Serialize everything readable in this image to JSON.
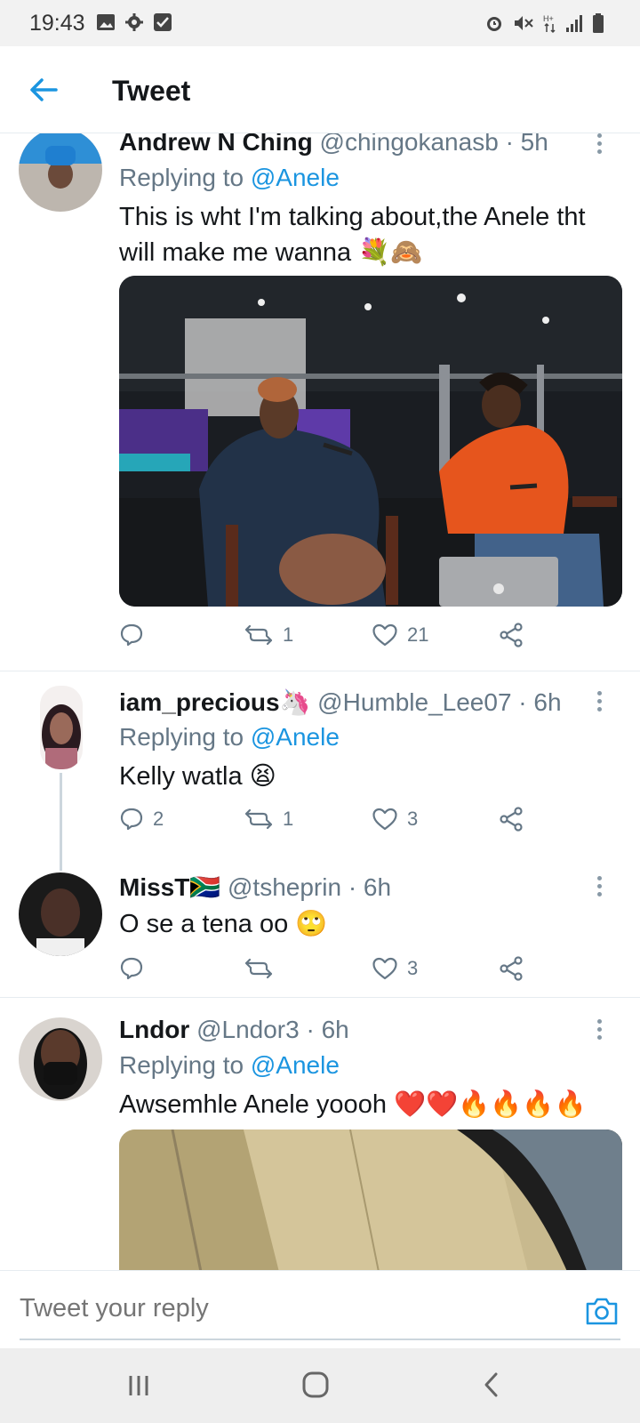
{
  "status_bar": {
    "time": "19:43",
    "left_icons": [
      "image-icon",
      "gear-icon",
      "checkbox-icon"
    ],
    "right_icons": [
      "alarm-icon",
      "mute-icon",
      "data-icon",
      "signal-icon",
      "battery-icon"
    ]
  },
  "header": {
    "back_icon": "arrow-left-icon",
    "title": "Tweet"
  },
  "tweets": [
    {
      "name": "Andrew N Ching",
      "handle": "@chingokanasb",
      "time": "· 5h",
      "replying_prefix": "Replying to",
      "replying_to": "@Anele",
      "text": "This is wht I'm talking about,the Anele tht will make me wanna 💐🙈",
      "has_photo": true,
      "reply_count": "",
      "retweet_count": "1",
      "like_count": "21"
    },
    {
      "name": "iam_precious🦄",
      "handle": "@Humble_Lee07",
      "time": "· 6h",
      "replying_prefix": "Replying to",
      "replying_to": "@Anele",
      "text": "Kelly watla 😫",
      "reply_count": "2",
      "retweet_count": "1",
      "like_count": "3"
    },
    {
      "name": "MissT🇿🇦",
      "handle": "@tsheprin",
      "time": "· 6h",
      "text": "O se a tena oo 🙄",
      "reply_count": "",
      "retweet_count": "",
      "like_count": "3"
    },
    {
      "name": "Lndor",
      "handle": "@Lndor3",
      "time": "· 6h",
      "replying_prefix": "Replying to",
      "replying_to": "@Anele",
      "text": "Awsemhle Anele yoooh ❤️❤️🔥🔥🔥🔥",
      "has_photo": true
    }
  ],
  "reply_box": {
    "placeholder": "Tweet your reply",
    "camera_icon": "camera-icon"
  },
  "nav_bar": {
    "icons": [
      "recent-apps-icon",
      "home-icon",
      "back-icon"
    ]
  },
  "colors": {
    "accent": "#1b95e0",
    "secondary_text": "#657786",
    "divider": "#e6ecf0"
  }
}
